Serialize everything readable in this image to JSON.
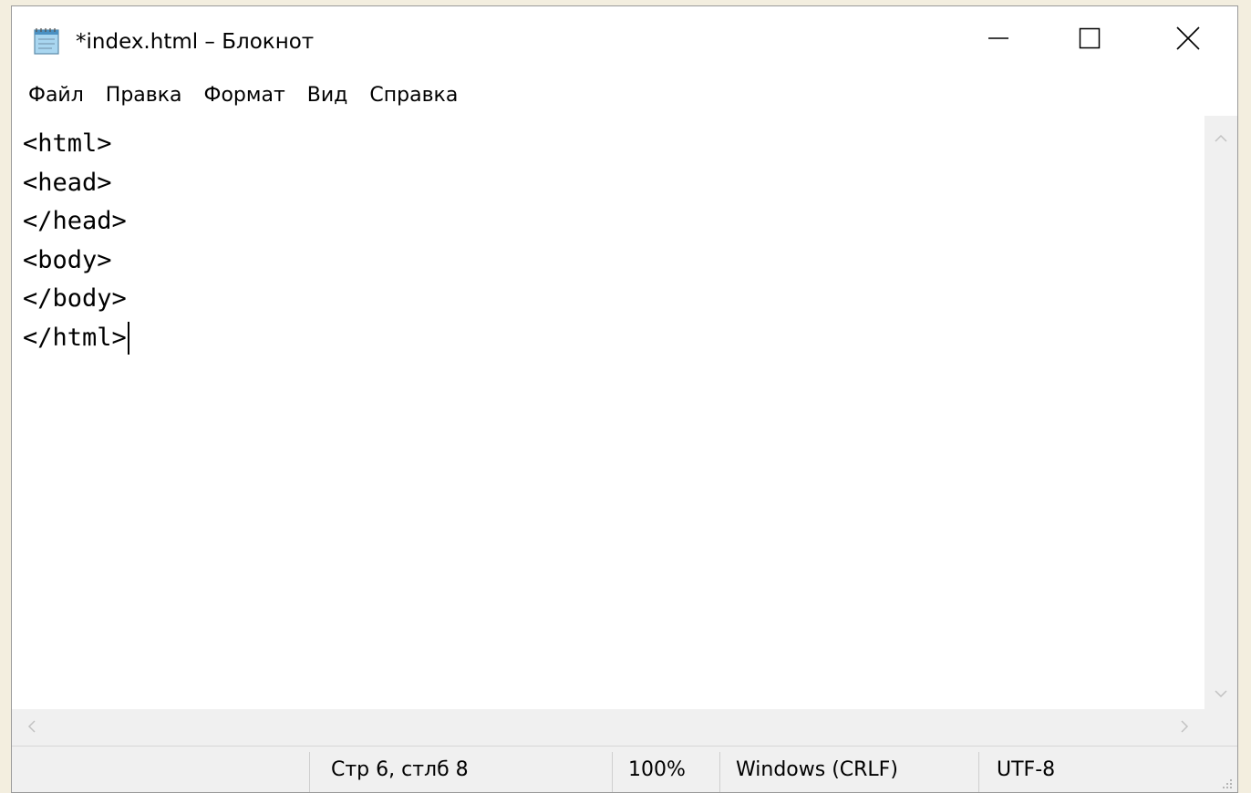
{
  "window": {
    "title": "*index.html – Блокнот"
  },
  "menu": {
    "items": [
      {
        "label": "Файл"
      },
      {
        "label": "Правка"
      },
      {
        "label": "Формат"
      },
      {
        "label": "Вид"
      },
      {
        "label": "Справка"
      }
    ]
  },
  "editor": {
    "lines": [
      "<html>",
      "<head>",
      "</head>",
      "<body>",
      "</body>",
      "</html>"
    ]
  },
  "status": {
    "position": "Стр 6, стлб 8",
    "zoom": "100%",
    "line_ending": "Windows (CRLF)",
    "encoding": "UTF-8"
  },
  "icons": {
    "app": "notepad-icon",
    "minimize": "minimize-icon",
    "maximize": "maximize-icon",
    "close": "close-icon"
  },
  "colors": {
    "desktop_background": "#f3eedf",
    "window_background": "#ffffff",
    "chrome_gray": "#f0f0f0"
  }
}
